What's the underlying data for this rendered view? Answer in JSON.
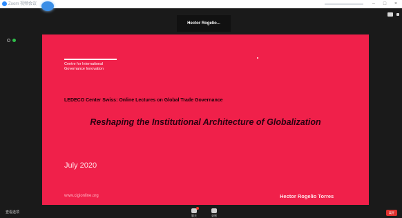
{
  "window": {
    "title": "Zoom 视频会议",
    "minimize": "–",
    "maximize": "□",
    "close": "×"
  },
  "speaker": {
    "name": "Hector Rogelio..."
  },
  "slide": {
    "org_line1": "Centre for International",
    "org_line2": "Governance Innovation",
    "series": "LEDECO Center Swiss: Online Lectures on Global Trade Governance",
    "headline": "Reshaping the Institutional Architecture of Globalization",
    "date": "July 2020",
    "url": "www.cigionline.org",
    "presenter": "Hector Rogelio Torres",
    "background_color": "#f0204a"
  },
  "toolbar": {
    "left_label": "查看选项",
    "chat_label": "聊天",
    "record_label": "录制",
    "end_label": "离开"
  }
}
